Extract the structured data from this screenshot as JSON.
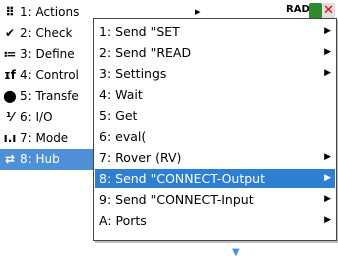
{
  "status": {
    "arrow": "▸",
    "mode": "RAD",
    "close": "✕"
  },
  "main_menu": [
    {
      "glyph": "⠿",
      "label": "1: Actions"
    },
    {
      "glyph": "✔",
      "label": "2: Check"
    },
    {
      "glyph": "≔",
      "label": "3: Define"
    },
    {
      "glyph": "ɪf",
      "label": "4: Control"
    },
    {
      "glyph": "⬤",
      "label": "5: Transfe"
    },
    {
      "glyph": "⅟",
      "label": "6: I/O"
    },
    {
      "glyph": "ı.ı",
      "label": "7: Mode"
    },
    {
      "glyph": "⇄",
      "label": "8: Hub"
    }
  ],
  "submenu": [
    {
      "label": "1: Send \"SET",
      "has_arrow": true
    },
    {
      "label": "2: Send \"READ",
      "has_arrow": true
    },
    {
      "label": "3: Settings",
      "has_arrow": true
    },
    {
      "label": "4: Wait",
      "has_arrow": false
    },
    {
      "label": "5: Get",
      "has_arrow": false
    },
    {
      "label": "6: eval(",
      "has_arrow": false
    },
    {
      "label": "7: Rover (RV)",
      "has_arrow": true
    },
    {
      "label": "8: Send \"CONNECT-Output",
      "has_arrow": true
    },
    {
      "label": "9: Send \"CONNECT-Input",
      "has_arrow": true
    },
    {
      "label": "A: Ports",
      "has_arrow": true
    }
  ],
  "submenu_arrow_glyph": "▶",
  "scroll_indicator": "▼",
  "colors": {
    "selection": "#2e7fd0",
    "active_main": "#4f8fd6"
  }
}
